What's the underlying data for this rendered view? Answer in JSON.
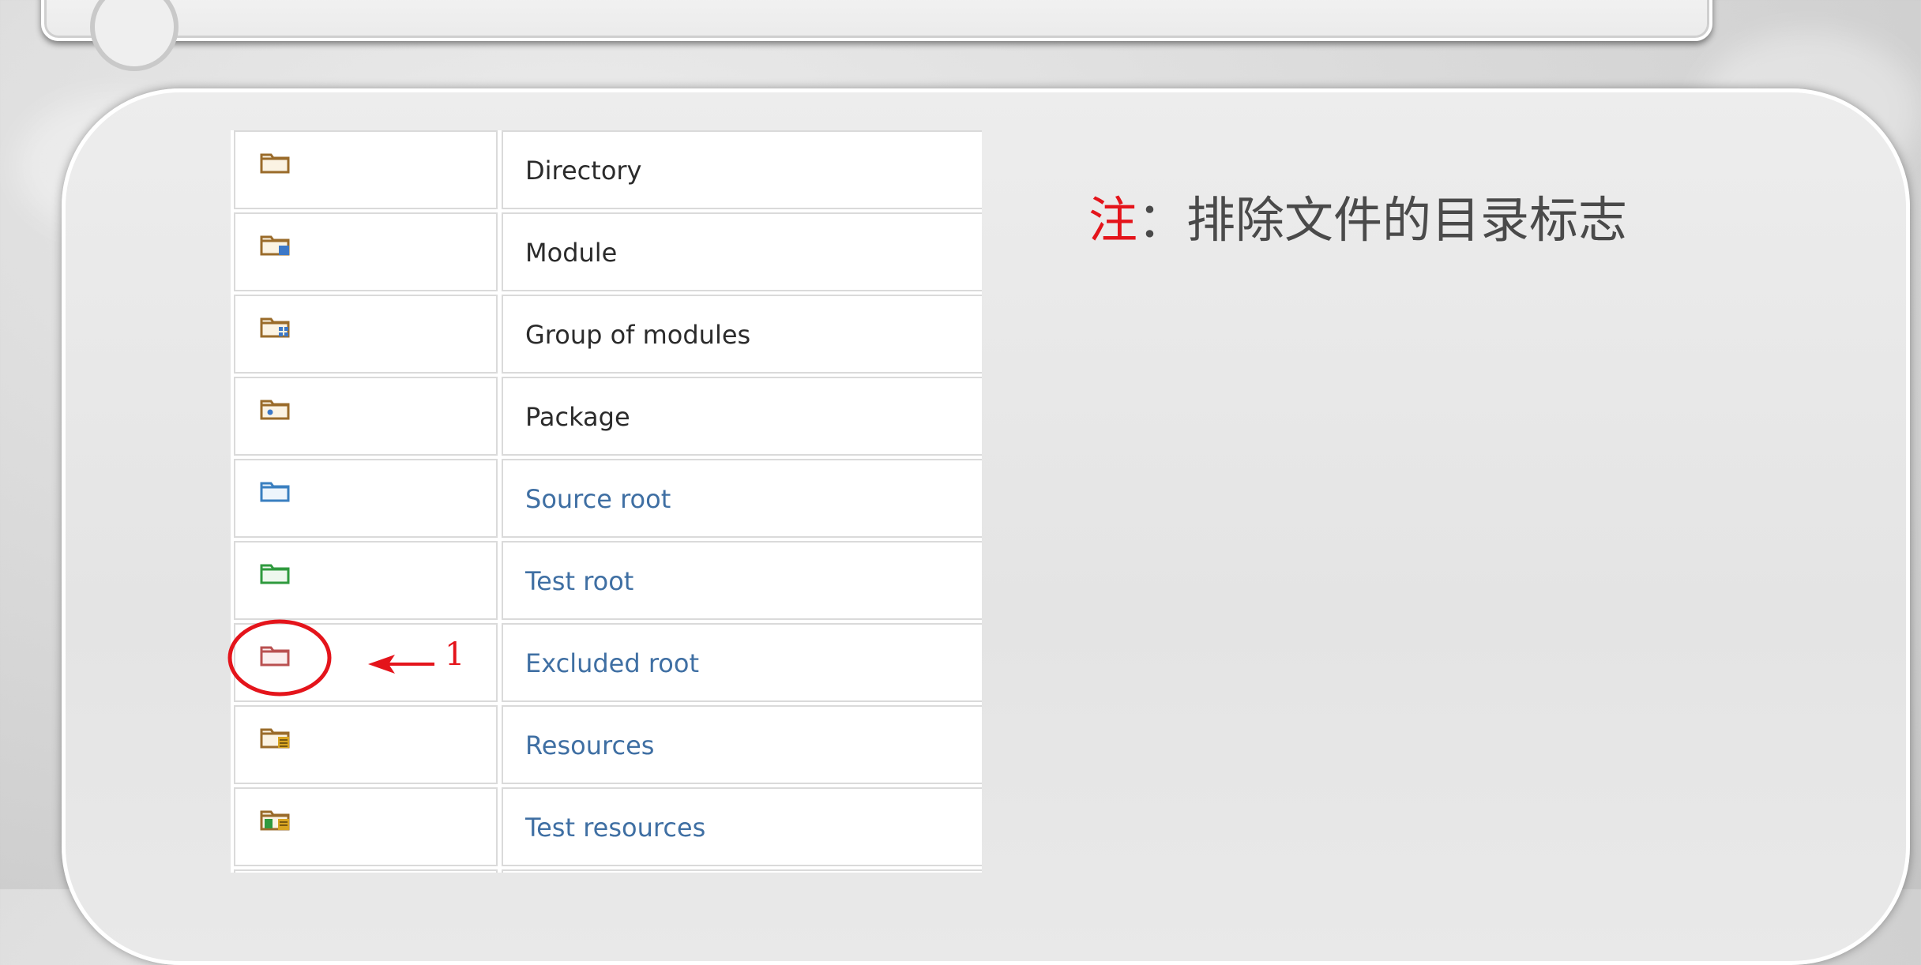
{
  "note": {
    "marker": "注",
    "text": "：排除文件的目录标志"
  },
  "annotation": {
    "number": "1"
  },
  "table": {
    "rows": [
      {
        "icon": "folder-directory-icon",
        "label": "Directory",
        "style": "plain"
      },
      {
        "icon": "folder-module-icon",
        "label": "Module",
        "style": "plain"
      },
      {
        "icon": "folder-module-group-icon",
        "label": "Group of modules",
        "style": "plain"
      },
      {
        "icon": "folder-package-icon",
        "label": "Package",
        "style": "plain"
      },
      {
        "icon": "folder-source-root-icon",
        "label": "Source root",
        "style": "link"
      },
      {
        "icon": "folder-test-root-icon",
        "label": "Test root",
        "style": "link"
      },
      {
        "icon": "folder-excluded-root-icon",
        "label": "Excluded root",
        "style": "link"
      },
      {
        "icon": "folder-resources-icon",
        "label": "Resources",
        "style": "link"
      },
      {
        "icon": "folder-test-resources-icon",
        "label": "Test resources",
        "style": "link"
      }
    ]
  },
  "colors": {
    "note_marker": "#e4141b",
    "link_text": "#3f6fa3",
    "annotation_red": "#e4141b"
  }
}
